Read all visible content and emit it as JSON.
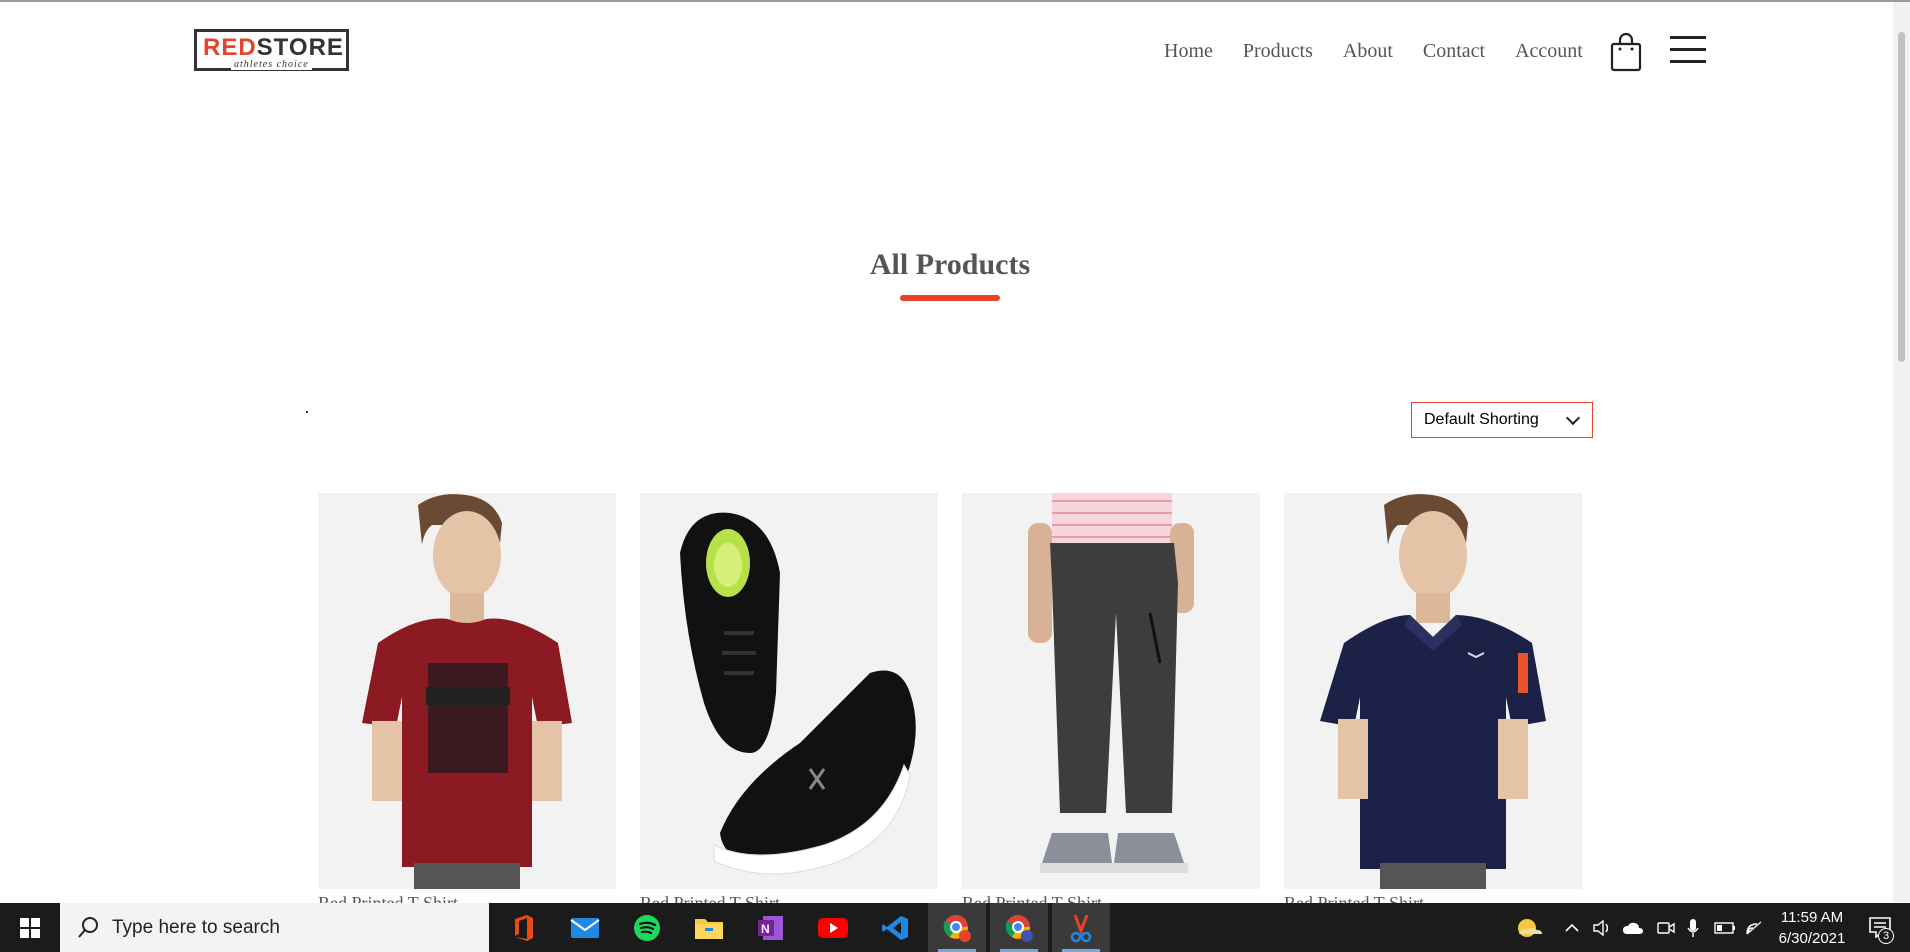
{
  "brand": {
    "logo_main_red": "RED",
    "logo_main_dark": "STORE",
    "logo_tagline": "athletes choice"
  },
  "nav": {
    "items": [
      "Home",
      "Products",
      "About",
      "Contact",
      "Account"
    ]
  },
  "page": {
    "title": "All Products"
  },
  "sort": {
    "selected": "Default Shorting"
  },
  "products": [
    {
      "name": "Red Printed T-Shirt",
      "image": "red-tshirt"
    },
    {
      "name": "Red Printed T-Shirt",
      "image": "black-sneakers"
    },
    {
      "name": "Red Printed T-Shirt",
      "image": "grey-joggers"
    },
    {
      "name": "Red Printed T-Shirt",
      "image": "navy-polo"
    }
  ],
  "taskbar": {
    "search_placeholder": "Type here to search",
    "time": "11:59 AM",
    "date": "6/30/2021",
    "notification_count": "3",
    "apps": [
      "office-icon",
      "mail-icon",
      "spotify-icon",
      "file-explorer-icon",
      "onenote-icon",
      "youtube-icon",
      "vscode-icon",
      "chrome-icon",
      "chrome-profile-icon",
      "snipping-tool-icon"
    ]
  },
  "colors": {
    "accent": "#e8412c",
    "text": "#555555",
    "taskbar": "#1b1b1b"
  }
}
